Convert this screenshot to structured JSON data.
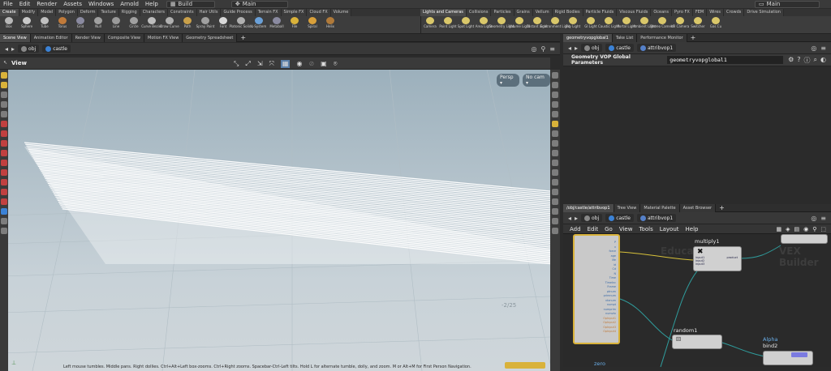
{
  "menubar": {
    "items": [
      "File",
      "Edit",
      "Render",
      "Assets",
      "Windows",
      "Arnold",
      "Help"
    ],
    "desktop": "Build",
    "scene": "Main",
    "right_scene": "Main"
  },
  "shelf": {
    "left_tabs": [
      "Create",
      "Modify",
      "Model",
      "Polygon",
      "Deform",
      "Texture",
      "Rigging",
      "Characters",
      "Constraints",
      "Hair Utils",
      "Guide Process",
      "Terrain FX",
      "Simple FX",
      "Cloud FX",
      "Volume"
    ],
    "right_tabs": [
      "Lights and Cameras",
      "Collisions",
      "Particles",
      "Grains",
      "Vellum",
      "Rigid Bodies",
      "Particle Fluids",
      "Viscous Fluids",
      "Oceans",
      "Pyro FX",
      "FEM",
      "Wires",
      "Crowds",
      "Drive Simulation"
    ],
    "left_tools": [
      "Box",
      "Sphere",
      "Tube",
      "Torus",
      "Grid",
      "Null",
      "Line",
      "Circle",
      "Curve Bezier",
      "Draw Curve",
      "Path",
      "Spray Paint",
      "Font",
      "Platonic Solids",
      "L-System",
      "Metaball",
      "File",
      "Spiral",
      "Helix"
    ],
    "right_tools": [
      "Camera",
      "Point Light",
      "Spot Light",
      "Area Light",
      "Geometry Light",
      "Volume Light",
      "Distant Light",
      "Environment Light",
      "Sky Light",
      "GI Light",
      "Caustic Light",
      "Portal Light",
      "Ambient Light",
      "Stereo Camera",
      "VR Camera",
      "Switcher",
      "Gas Cu"
    ]
  },
  "left_pane": {
    "tabs": [
      "Scene View",
      "Animation Editor",
      "Render View",
      "Composite View",
      "Motion FX View",
      "Geometry Spreadsheet"
    ],
    "path": [
      "obj",
      "castle"
    ],
    "view_title": "View",
    "persp": "Persp ▾",
    "cam": "No cam ▾",
    "status": "Left mouse tumbles. Middle pans. Right dollies. Ctrl+Alt+Left box-zooms. Ctrl+Right zooms. Spacebar-Ctrl-Left tilts. Hold L for alternate tumble, dolly, and zoom.     M or Alt+M for First Person Navigation.",
    "grid_label": "-2/25"
  },
  "param_pane": {
    "tabs": [
      "geometryvopglobal1",
      "Take List",
      "Performance Monitor"
    ],
    "path": [
      "obj",
      "castle",
      "attribvop1"
    ],
    "label": "Geometry VOP Global Parameters",
    "value": "geometryvopglobal1"
  },
  "network_pane": {
    "tabs": [
      "/obj/castle/attribvop1",
      "Tree View",
      "Material Palette",
      "Asset Browser"
    ],
    "path": [
      "obj",
      "castle",
      "attribvop1"
    ],
    "menu": [
      "Add",
      "Edit",
      "Go",
      "View",
      "Tools",
      "Layout",
      "Help"
    ],
    "watermark_left": "Educat",
    "watermark_right": "VEX Builder",
    "nodes": {
      "multiply": "multiply1",
      "random": "random1",
      "bind_type": "Alpha",
      "bind": "bind2",
      "zero": "zero"
    },
    "global_ports": [
      "P",
      "v",
      "force",
      "age",
      "life",
      "id",
      "Cd",
      "N",
      "Time",
      "TimeInc",
      "Frame",
      "ptnum",
      "primnum",
      "vtxnum",
      "numpt",
      "numprim",
      "numvtx",
      "OpInput1",
      "OpInput2",
      "OpInput3",
      "OpInput4"
    ],
    "multiply_in": [
      "input1",
      "input2",
      "input3"
    ],
    "multiply_out": "product"
  },
  "colors": {
    "accent_yellow": "#d9b23a",
    "wire_teal": "#2f9c9c",
    "wire_yellow": "#d7c13a"
  }
}
